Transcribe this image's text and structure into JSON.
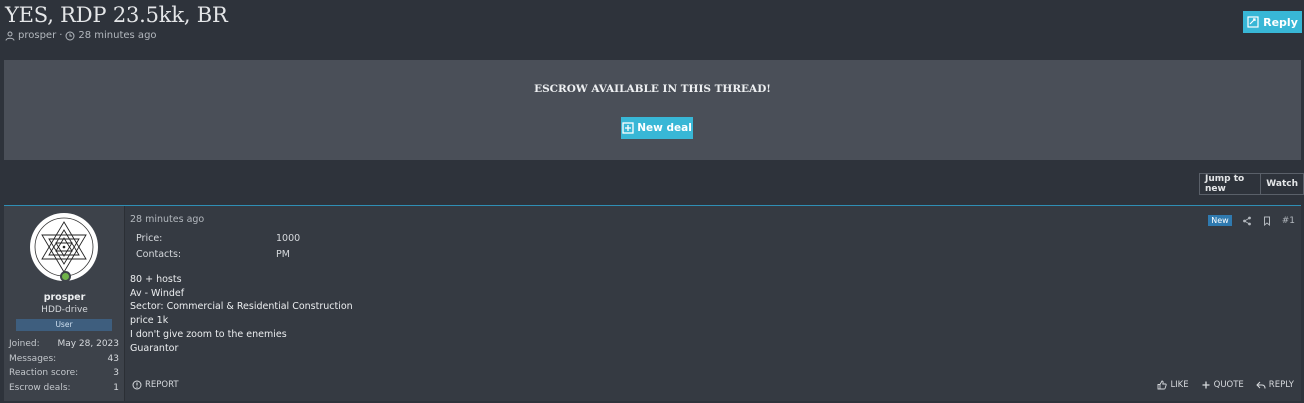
{
  "thread": {
    "title": "YES, RDP 23.5kk, BR",
    "author": "prosper",
    "separator": "·",
    "time": "28 minutes ago",
    "reply_label": "Reply"
  },
  "escrow": {
    "title": "ESCROW AVAILABLE IN THIS THREAD!",
    "new_deal_label": "New deal"
  },
  "thread_buttons": {
    "jump_to_new": "Jump to new",
    "watch": "Watch"
  },
  "post": {
    "time": "28 minutes ago",
    "new_badge": "New",
    "number": "#1",
    "fields": [
      {
        "label": "Price:",
        "value": "1000"
      },
      {
        "label": "Contacts:",
        "value": "PM"
      }
    ],
    "body_lines": [
      "80 + hosts",
      "Av - Windef",
      "Sector: Commercial & Residential Construction",
      "price 1k",
      "I don't give zoom to the enemies",
      "Guarantor"
    ],
    "report_label": "REPORT",
    "like_label": "LIKE",
    "quote_label": "QUOTE",
    "reply_label": "REPLY"
  },
  "user": {
    "name": "prosper",
    "title": "HDD-drive",
    "banner": "User",
    "stats": [
      {
        "label": "Joined:",
        "value": "May 28, 2023"
      },
      {
        "label": "Messages:",
        "value": "43"
      },
      {
        "label": "Reaction score:",
        "value": "3"
      },
      {
        "label": "Escrow deals:",
        "value": "1"
      }
    ]
  },
  "colors": {
    "background": "#2e333b",
    "accent": "#38b7d6",
    "escrow_panel": "#4a4f58",
    "post_top_border": "#2f8fb5",
    "new_badge": "#2f7ab0",
    "online": "#70b34a"
  },
  "icons": [
    "user-icon",
    "clock-icon",
    "reply-icon",
    "plus-square-icon",
    "share-icon",
    "bookmark-icon",
    "report-icon",
    "like-icon",
    "quote-icon",
    "reply-arrow-icon",
    "online-indicator"
  ]
}
